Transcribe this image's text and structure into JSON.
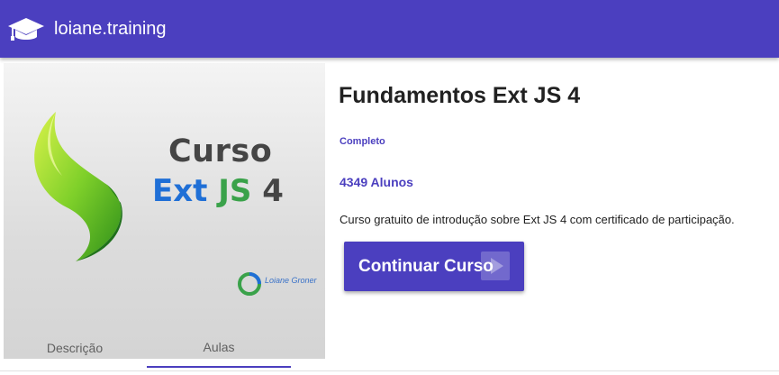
{
  "toolbar": {
    "brand": "loiane.training",
    "logo_icon": "graduation-cap-icon"
  },
  "course": {
    "title": "Fundamentos Ext JS 4",
    "status": "Completo",
    "students": "4349 Alunos",
    "description": "Curso gratuito de introdução sobre Ext JS 4 com certificado de participação.",
    "button_label": "Continuar Curso",
    "thumbnail": {
      "line1": "Curso",
      "ext": "Ext",
      "js": "JS",
      "version": "4",
      "brand": "Loiane Groner"
    }
  },
  "tabs": [
    {
      "label": "Descrição",
      "active": false
    },
    {
      "label": "Aulas",
      "active": true
    }
  ],
  "colors": {
    "primary": "#4b3fbf",
    "ext_blue": "#1f6fd6",
    "js_green": "#3aa24a"
  }
}
